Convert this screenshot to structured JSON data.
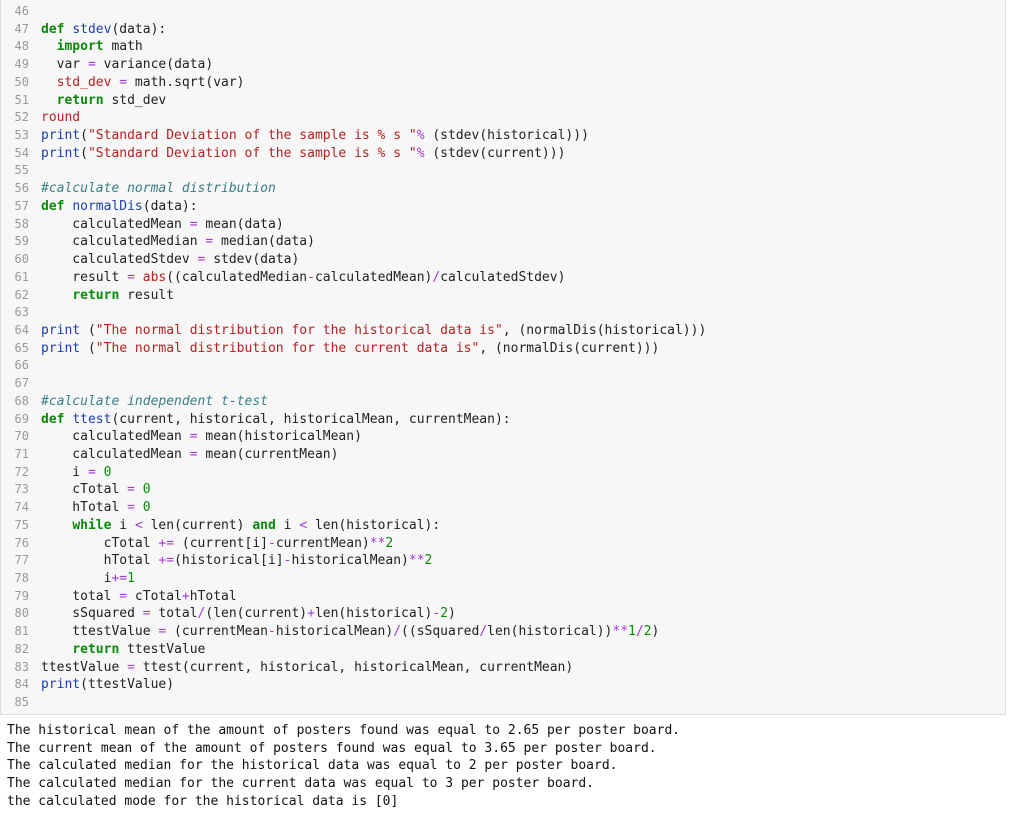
{
  "code_lines": [
    {
      "n": "46",
      "segs": []
    },
    {
      "n": "47",
      "segs": [
        [
          "kw",
          "def "
        ],
        [
          "fn",
          "stdev"
        ],
        [
          "",
          "(data):"
        ]
      ]
    },
    {
      "n": "48",
      "segs": [
        [
          "",
          "  "
        ],
        [
          "kw",
          "import"
        ],
        [
          "",
          " math"
        ]
      ]
    },
    {
      "n": "49",
      "segs": [
        [
          "",
          "  var "
        ],
        [
          "op",
          "="
        ],
        [
          "",
          " variance(data)"
        ]
      ]
    },
    {
      "n": "50",
      "segs": [
        [
          "",
          "  "
        ],
        [
          "str",
          "std_dev"
        ],
        [
          "",
          " "
        ],
        [
          "op",
          "="
        ],
        [
          "",
          " math.sqrt(var)"
        ]
      ]
    },
    {
      "n": "51",
      "segs": [
        [
          "",
          "  "
        ],
        [
          "kw",
          "return"
        ],
        [
          "",
          " std_dev"
        ]
      ]
    },
    {
      "n": "52",
      "segs": [
        [
          "str",
          "round"
        ]
      ]
    },
    {
      "n": "53",
      "segs": [
        [
          "fn",
          "print"
        ],
        [
          "",
          "("
        ],
        [
          "str",
          "\"Standard Deviation of the sample is % s \""
        ],
        [
          "op",
          "%"
        ],
        [
          "",
          " (stdev(historical)))"
        ]
      ]
    },
    {
      "n": "54",
      "segs": [
        [
          "fn",
          "print"
        ],
        [
          "",
          "("
        ],
        [
          "str",
          "\"Standard Deviation of the sample is % s \""
        ],
        [
          "op",
          "%"
        ],
        [
          "",
          " (stdev(current)))"
        ]
      ]
    },
    {
      "n": "55",
      "segs": []
    },
    {
      "n": "56",
      "segs": [
        [
          "cm",
          "#calculate normal distribution"
        ]
      ]
    },
    {
      "n": "57",
      "segs": [
        [
          "kw",
          "def "
        ],
        [
          "fn",
          "normalDis"
        ],
        [
          "",
          "(data):"
        ]
      ]
    },
    {
      "n": "58",
      "segs": [
        [
          "",
          "    calculatedMean "
        ],
        [
          "op",
          "="
        ],
        [
          "",
          " mean(data)"
        ]
      ]
    },
    {
      "n": "59",
      "segs": [
        [
          "",
          "    calculatedMedian "
        ],
        [
          "op",
          "="
        ],
        [
          "",
          " median(data)"
        ]
      ]
    },
    {
      "n": "60",
      "segs": [
        [
          "",
          "    calculatedStdev "
        ],
        [
          "op",
          "="
        ],
        [
          "",
          " stdev(data)"
        ]
      ]
    },
    {
      "n": "61",
      "segs": [
        [
          "",
          "    result "
        ],
        [
          "op",
          "="
        ],
        [
          "",
          " "
        ],
        [
          "str",
          "abs"
        ],
        [
          "",
          "((calculatedMedian"
        ],
        [
          "op",
          "-"
        ],
        [
          "",
          "calculatedMean)"
        ],
        [
          "op",
          "/"
        ],
        [
          "",
          "calculatedStdev)"
        ]
      ]
    },
    {
      "n": "62",
      "segs": [
        [
          "",
          "    "
        ],
        [
          "kw",
          "return"
        ],
        [
          "",
          " result"
        ]
      ]
    },
    {
      "n": "63",
      "segs": []
    },
    {
      "n": "64",
      "segs": [
        [
          "fn",
          "print"
        ],
        [
          "",
          " ("
        ],
        [
          "str",
          "\"The normal distribution for the historical data is\""
        ],
        [
          "",
          ", (normalDis(historical)))"
        ]
      ]
    },
    {
      "n": "65",
      "segs": [
        [
          "fn",
          "print"
        ],
        [
          "",
          " ("
        ],
        [
          "str",
          "\"The normal distribution for the current data is\""
        ],
        [
          "",
          ", (normalDis(current)))"
        ]
      ]
    },
    {
      "n": "66",
      "segs": []
    },
    {
      "n": "67",
      "segs": []
    },
    {
      "n": "68",
      "segs": [
        [
          "cm",
          "#calculate independent t-test"
        ]
      ]
    },
    {
      "n": "69",
      "segs": [
        [
          "kw",
          "def "
        ],
        [
          "fn",
          "ttest"
        ],
        [
          "",
          "(current, historical, historicalMean, currentMean):"
        ]
      ]
    },
    {
      "n": "70",
      "segs": [
        [
          "",
          "    calculatedMean "
        ],
        [
          "op",
          "="
        ],
        [
          "",
          " mean(historicalMean)"
        ]
      ]
    },
    {
      "n": "71",
      "segs": [
        [
          "",
          "    calculatedMean "
        ],
        [
          "op",
          "="
        ],
        [
          "",
          " mean(currentMean)"
        ]
      ]
    },
    {
      "n": "72",
      "segs": [
        [
          "",
          "    i "
        ],
        [
          "op",
          "="
        ],
        [
          "",
          " "
        ],
        [
          "num",
          "0"
        ]
      ]
    },
    {
      "n": "73",
      "segs": [
        [
          "",
          "    cTotal "
        ],
        [
          "op",
          "="
        ],
        [
          "",
          " "
        ],
        [
          "num",
          "0"
        ]
      ]
    },
    {
      "n": "74",
      "segs": [
        [
          "",
          "    hTotal "
        ],
        [
          "op",
          "="
        ],
        [
          "",
          " "
        ],
        [
          "num",
          "0"
        ]
      ]
    },
    {
      "n": "75",
      "segs": [
        [
          "",
          "    "
        ],
        [
          "kw",
          "while"
        ],
        [
          "",
          " i "
        ],
        [
          "op",
          "<"
        ],
        [
          "",
          " len(current) "
        ],
        [
          "kw",
          "and"
        ],
        [
          "",
          " i "
        ],
        [
          "op",
          "<"
        ],
        [
          "",
          " len(historical):"
        ]
      ]
    },
    {
      "n": "76",
      "segs": [
        [
          "",
          "        cTotal "
        ],
        [
          "op",
          "+="
        ],
        [
          "",
          " (current[i]"
        ],
        [
          "op",
          "-"
        ],
        [
          "",
          "currentMean)"
        ],
        [
          "op",
          "**"
        ],
        [
          "num",
          "2"
        ]
      ]
    },
    {
      "n": "77",
      "segs": [
        [
          "",
          "        hTotal "
        ],
        [
          "op",
          "+="
        ],
        [
          "",
          "(historical[i]"
        ],
        [
          "op",
          "-"
        ],
        [
          "",
          "historicalMean)"
        ],
        [
          "op",
          "**"
        ],
        [
          "num",
          "2"
        ]
      ]
    },
    {
      "n": "78",
      "segs": [
        [
          "",
          "        i"
        ],
        [
          "op",
          "+="
        ],
        [
          "num",
          "1"
        ]
      ]
    },
    {
      "n": "79",
      "segs": [
        [
          "",
          "    total "
        ],
        [
          "op",
          "="
        ],
        [
          "",
          " cTotal"
        ],
        [
          "op",
          "+"
        ],
        [
          "",
          "hTotal"
        ]
      ]
    },
    {
      "n": "80",
      "segs": [
        [
          "",
          "    sSquared "
        ],
        [
          "op",
          "="
        ],
        [
          "",
          " total"
        ],
        [
          "op",
          "/"
        ],
        [
          "",
          "(len(current)"
        ],
        [
          "op",
          "+"
        ],
        [
          "",
          "len(historical)"
        ],
        [
          "op",
          "-"
        ],
        [
          "num",
          "2"
        ],
        [
          "",
          ")"
        ]
      ]
    },
    {
      "n": "81",
      "segs": [
        [
          "",
          "    ttestValue "
        ],
        [
          "op",
          "="
        ],
        [
          "",
          " (currentMean"
        ],
        [
          "op",
          "-"
        ],
        [
          "",
          "historicalMean)"
        ],
        [
          "op",
          "/"
        ],
        [
          "",
          "((sSquared"
        ],
        [
          "op",
          "/"
        ],
        [
          "",
          "len(historical))"
        ],
        [
          "op",
          "**"
        ],
        [
          "num",
          "1"
        ],
        [
          "op",
          "/"
        ],
        [
          "num",
          "2"
        ],
        [
          "",
          ")"
        ]
      ]
    },
    {
      "n": "82",
      "segs": [
        [
          "",
          "    "
        ],
        [
          "kw",
          "return"
        ],
        [
          "",
          " ttestValue"
        ]
      ]
    },
    {
      "n": "83",
      "segs": [
        [
          "",
          "ttestValue "
        ],
        [
          "op",
          "="
        ],
        [
          "",
          " ttest(current, historical, historicalMean, currentMean)"
        ]
      ]
    },
    {
      "n": "84",
      "segs": [
        [
          "fn",
          "print"
        ],
        [
          "",
          "(ttestValue)"
        ]
      ]
    },
    {
      "n": "85",
      "segs": []
    }
  ],
  "output_lines": [
    "The historical mean of the amount of posters found was equal to 2.65 per poster board.",
    "The current mean of the amount of posters found was equal to 3.65 per poster board.",
    "The calculated median for the historical data was equal to 2 per poster board.",
    "The calculated median for the current data was equal to 3 per poster board.",
    "the calculated mode for the historical data is [0]"
  ]
}
